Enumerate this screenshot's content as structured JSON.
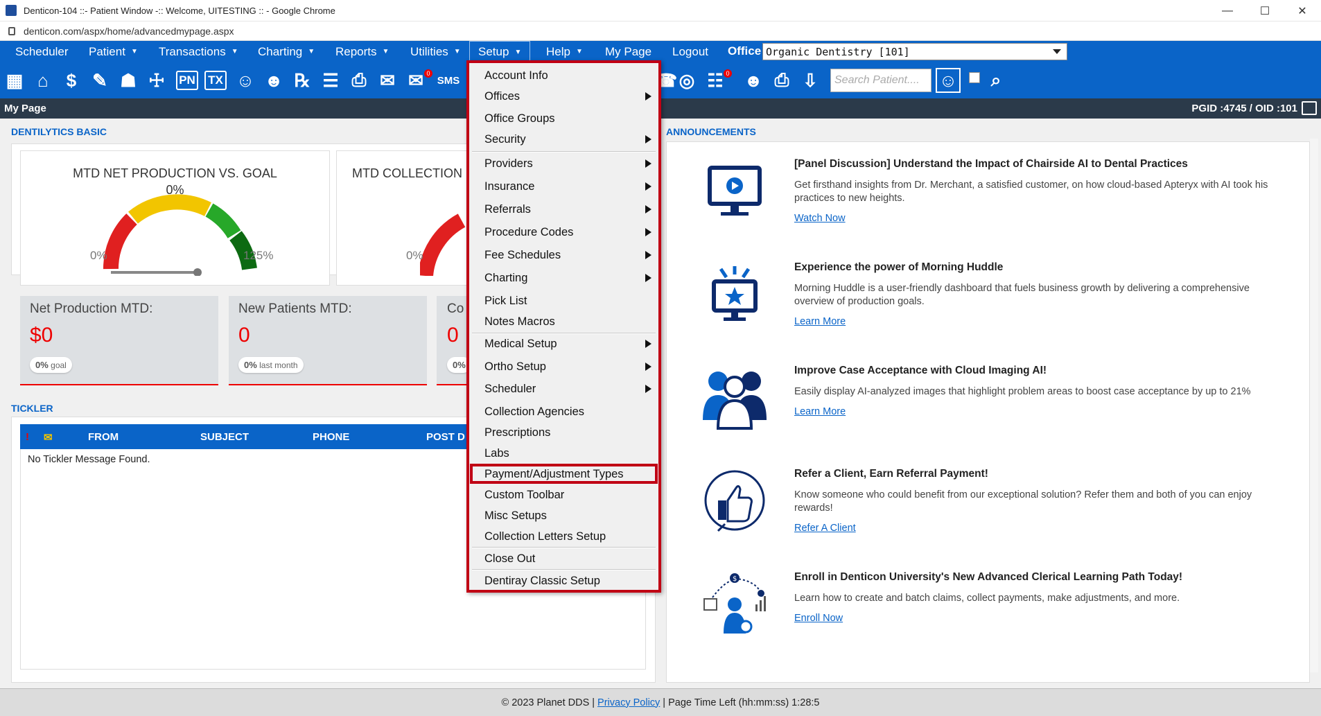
{
  "window": {
    "title": "Denticon-104 ::- Patient Window -:: Welcome, UITESTING :: - Google Chrome",
    "url": "denticon.com/aspx/home/advancedmypage.aspx",
    "controls": [
      "—",
      "☐",
      "✕"
    ]
  },
  "nav": {
    "items": [
      {
        "label": "Scheduler",
        "caret": ""
      },
      {
        "label": "Patient",
        "caret": "▼"
      },
      {
        "label": "Transactions",
        "caret": "▼"
      },
      {
        "label": "Charting",
        "caret": "▼"
      },
      {
        "label": "Reports",
        "caret": "▼"
      },
      {
        "label": "Utilities",
        "caret": "▼"
      },
      {
        "label": "Setup",
        "caret": "▼"
      },
      {
        "label": "Help",
        "caret": "▼"
      },
      {
        "label": "My Page",
        "caret": ""
      },
      {
        "label": "Logout",
        "caret": ""
      }
    ],
    "office_label": "Office",
    "office_value": "Organic Dentistry [101]"
  },
  "toolbar": {
    "search_placeholder": "Search Patient....",
    "badge_count": "0"
  },
  "pagebar": {
    "title": "My Page",
    "ids": "PGID :4745  /  OID :101"
  },
  "dentilytics": {
    "section_title": "DENTILYTICS BASIC",
    "gauges": [
      {
        "title": "MTD NET PRODUCTION VS. GOAL",
        "percent": "0%",
        "min": "0%",
        "max": "125%"
      },
      {
        "title": "MTD COLLECTION",
        "percent": "",
        "min": "0%",
        "max": ""
      }
    ],
    "stats": [
      {
        "label": "Net Production MTD:",
        "value": "$0",
        "pill_value": "0%",
        "pill_text": "goal"
      },
      {
        "label": "New Patients MTD:",
        "value": "0",
        "pill_value": "0%",
        "pill_text": "last month"
      },
      {
        "label": "Co",
        "value": "0",
        "pill_value": "0%",
        "pill_text": ""
      }
    ]
  },
  "tickler": {
    "section_title": "TICKLER",
    "columns": [
      "FROM",
      "SUBJECT",
      "PHONE",
      "POST D"
    ],
    "empty_message": "No Tickler Message Found."
  },
  "announcements": {
    "section_title": "ANNOUNCEMENTS",
    "items": [
      {
        "title": "[Panel Discussion] Understand the Impact of Chairside AI to Dental Practices",
        "text": "Get firsthand insights from Dr. Merchant, a satisfied customer, on how cloud-based Apteryx with AI took his practices to new heights.",
        "link": "Watch Now",
        "icon": "monitor-play-icon"
      },
      {
        "title": "Experience the power of Morning Huddle",
        "text": "Morning Huddle is a user-friendly dashboard that fuels business growth by delivering a comprehensive overview of production goals.",
        "link": "Learn More",
        "icon": "monitor-star-icon"
      },
      {
        "title": "Improve Case Acceptance with Cloud Imaging AI!",
        "text": "Easily display AI-analyzed images that highlight problem areas to boost case acceptance by up to 21%",
        "link": "Learn More",
        "icon": "people-group-icon"
      },
      {
        "title": "Refer a Client, Earn Referral Payment!",
        "text": "Know someone who could benefit from our exceptional solution? Refer them and both of you can enjoy rewards!",
        "link": "Refer A Client",
        "icon": "thumbs-up-icon"
      },
      {
        "title": "Enroll in Denticon University's New Advanced Clerical Learning Path Today!",
        "text": "Learn how to create and batch claims, collect payments, make adjustments, and more.",
        "link": "Enroll Now",
        "icon": "learning-path-icon"
      }
    ]
  },
  "setup_menu": {
    "items": [
      {
        "label": "Account Info",
        "submenu": false
      },
      {
        "label": "Offices",
        "submenu": true
      },
      {
        "label": "Office Groups",
        "submenu": false
      },
      {
        "label": "Security",
        "submenu": true
      },
      {
        "label": "Providers",
        "submenu": true
      },
      {
        "label": "Insurance",
        "submenu": true
      },
      {
        "label": "Referrals",
        "submenu": true
      },
      {
        "label": "Procedure Codes",
        "submenu": true
      },
      {
        "label": "Fee Schedules",
        "submenu": true
      },
      {
        "label": "Charting",
        "submenu": true
      },
      {
        "label": "Pick List",
        "submenu": false
      },
      {
        "label": "Notes Macros",
        "submenu": false
      },
      {
        "label": "Medical Setup",
        "submenu": true
      },
      {
        "label": "Ortho Setup",
        "submenu": true
      },
      {
        "label": "Scheduler",
        "submenu": true
      },
      {
        "label": "Collection Agencies",
        "submenu": false
      },
      {
        "label": "Prescriptions",
        "submenu": false
      },
      {
        "label": "Labs",
        "submenu": false
      },
      {
        "label": "Payment/Adjustment Types",
        "submenu": false
      },
      {
        "label": "Custom Toolbar",
        "submenu": false
      },
      {
        "label": "Misc Setups",
        "submenu": false
      },
      {
        "label": "Collection Letters Setup",
        "submenu": false
      },
      {
        "label": "Close Out",
        "submenu": false
      },
      {
        "label": "Dentiray Classic Setup",
        "submenu": false
      }
    ]
  },
  "footer": {
    "copyright": "© 2023 Planet DDS |",
    "privacy": "Privacy Policy",
    "timer": "| Page Time Left (hh:mm:ss) 1:28:5"
  },
  "colors": {
    "nav_blue": "#0a64c8",
    "highlight_red": "#c00014",
    "stat_red": "#e00000"
  }
}
